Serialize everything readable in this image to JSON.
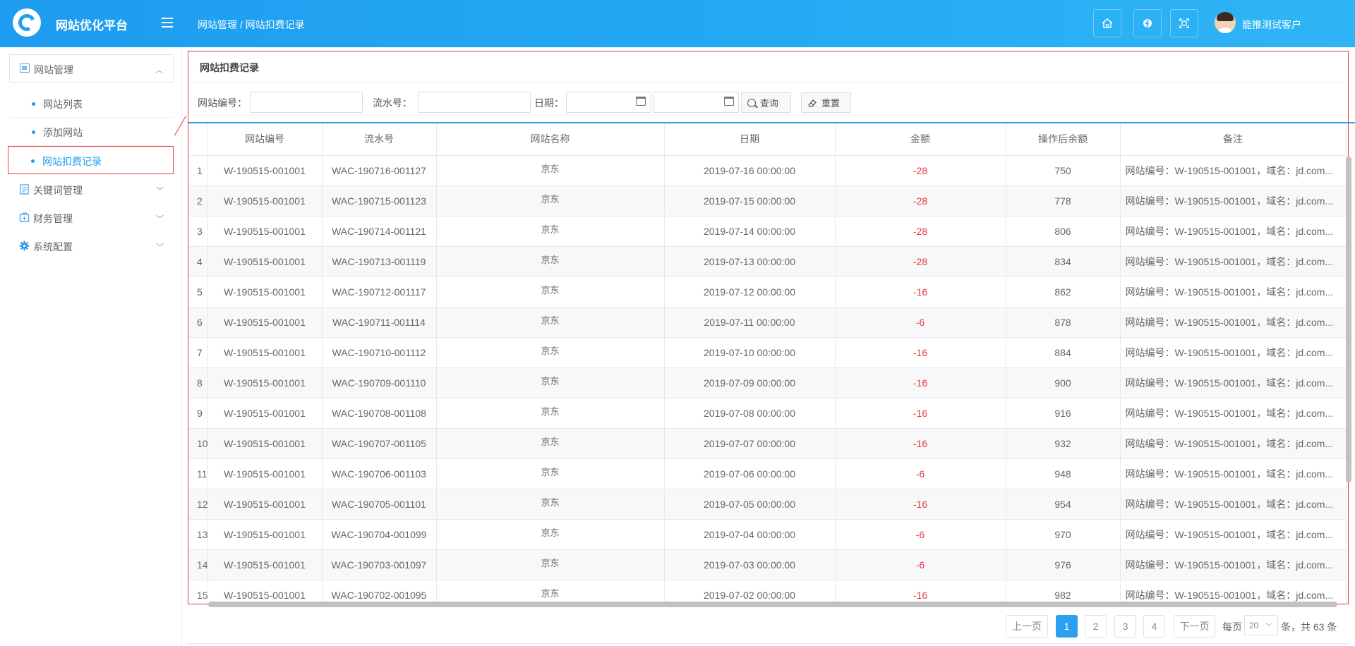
{
  "header": {
    "app_title": "网站优化平台",
    "breadcrumb": "网站管理 / 网站扣费记录",
    "user_name": "能推测试客户"
  },
  "sidebar": {
    "group_label": "网站管理",
    "sub_items": [
      {
        "label": "网站列表"
      },
      {
        "label": "添加网站"
      },
      {
        "label": "网站扣费记录"
      }
    ],
    "menu_items": [
      {
        "label": "关键词管理"
      },
      {
        "label": "财务管理"
      },
      {
        "label": "系统配置"
      }
    ]
  },
  "main": {
    "panel_title": "网站扣费记录",
    "filters": {
      "site_no_label": "网站编号：",
      "site_no_value": "",
      "serial_label": "流水号：",
      "serial_value": "",
      "date_label": "日期：",
      "date_start": "",
      "date_end": "",
      "search_btn": "查询",
      "reset_btn": "重置"
    },
    "columns": [
      "网站编号",
      "流水号",
      "网站名称",
      "日期",
      "金额",
      "操作后余额",
      "备注"
    ],
    "rows": [
      {
        "idx": "1",
        "site_no": "W-190515-001001",
        "serial": "WAC-190716-001127",
        "name": "京东",
        "date": "2019-07-16 00:00:00",
        "amount": "-28",
        "balance": "750",
        "note": "网站编号：W-190515-001001，域名：jd.com..."
      },
      {
        "idx": "2",
        "site_no": "W-190515-001001",
        "serial": "WAC-190715-001123",
        "name": "京东",
        "date": "2019-07-15 00:00:00",
        "amount": "-28",
        "balance": "778",
        "note": "网站编号：W-190515-001001，域名：jd.com..."
      },
      {
        "idx": "3",
        "site_no": "W-190515-001001",
        "serial": "WAC-190714-001121",
        "name": "京东",
        "date": "2019-07-14 00:00:00",
        "amount": "-28",
        "balance": "806",
        "note": "网站编号：W-190515-001001，域名：jd.com..."
      },
      {
        "idx": "4",
        "site_no": "W-190515-001001",
        "serial": "WAC-190713-001119",
        "name": "京东",
        "date": "2019-07-13 00:00:00",
        "amount": "-28",
        "balance": "834",
        "note": "网站编号：W-190515-001001，域名：jd.com..."
      },
      {
        "idx": "5",
        "site_no": "W-190515-001001",
        "serial": "WAC-190712-001117",
        "name": "京东",
        "date": "2019-07-12 00:00:00",
        "amount": "-16",
        "balance": "862",
        "note": "网站编号：W-190515-001001，域名：jd.com..."
      },
      {
        "idx": "6",
        "site_no": "W-190515-001001",
        "serial": "WAC-190711-001114",
        "name": "京东",
        "date": "2019-07-11 00:00:00",
        "amount": "-6",
        "balance": "878",
        "note": "网站编号：W-190515-001001，域名：jd.com..."
      },
      {
        "idx": "7",
        "site_no": "W-190515-001001",
        "serial": "WAC-190710-001112",
        "name": "京东",
        "date": "2019-07-10 00:00:00",
        "amount": "-16",
        "balance": "884",
        "note": "网站编号：W-190515-001001，域名：jd.com..."
      },
      {
        "idx": "8",
        "site_no": "W-190515-001001",
        "serial": "WAC-190709-001110",
        "name": "京东",
        "date": "2019-07-09 00:00:00",
        "amount": "-16",
        "balance": "900",
        "note": "网站编号：W-190515-001001，域名：jd.com..."
      },
      {
        "idx": "9",
        "site_no": "W-190515-001001",
        "serial": "WAC-190708-001108",
        "name": "京东",
        "date": "2019-07-08 00:00:00",
        "amount": "-16",
        "balance": "916",
        "note": "网站编号：W-190515-001001，域名：jd.com..."
      },
      {
        "idx": "10",
        "site_no": "W-190515-001001",
        "serial": "WAC-190707-001105",
        "name": "京东",
        "date": "2019-07-07 00:00:00",
        "amount": "-16",
        "balance": "932",
        "note": "网站编号：W-190515-001001，域名：jd.com..."
      },
      {
        "idx": "11",
        "site_no": "W-190515-001001",
        "serial": "WAC-190706-001103",
        "name": "京东",
        "date": "2019-07-06 00:00:00",
        "amount": "-6",
        "balance": "948",
        "note": "网站编号：W-190515-001001，域名：jd.com..."
      },
      {
        "idx": "12",
        "site_no": "W-190515-001001",
        "serial": "WAC-190705-001101",
        "name": "京东",
        "date": "2019-07-05 00:00:00",
        "amount": "-16",
        "balance": "954",
        "note": "网站编号：W-190515-001001，域名：jd.com..."
      },
      {
        "idx": "13",
        "site_no": "W-190515-001001",
        "serial": "WAC-190704-001099",
        "name": "京东",
        "date": "2019-07-04 00:00:00",
        "amount": "-6",
        "balance": "970",
        "note": "网站编号：W-190515-001001，域名：jd.com..."
      },
      {
        "idx": "14",
        "site_no": "W-190515-001001",
        "serial": "WAC-190703-001097",
        "name": "京东",
        "date": "2019-07-03 00:00:00",
        "amount": "-6",
        "balance": "976",
        "note": "网站编号：W-190515-001001，域名：jd.com..."
      },
      {
        "idx": "15",
        "site_no": "W-190515-001001",
        "serial": "WAC-190702-001095",
        "name": "京东",
        "date": "2019-07-02 00:00:00",
        "amount": "-16",
        "balance": "982",
        "note": "网站编号：W-190515-001001，域名：jd.com..."
      }
    ]
  },
  "pagination": {
    "prev": "上一页",
    "pages": [
      "1",
      "2",
      "3",
      "4"
    ],
    "current": "1",
    "next": "下一页",
    "per_page_label": "每页",
    "per_page": "20",
    "total_text": "条，共 63 条"
  },
  "colors": {
    "header_blue": "#1e9cf0",
    "amount_red": "#e8383d",
    "accent": "#2ba0f0"
  },
  "icons": {
    "header_buttons": [
      "home-icon",
      "refresh-icon",
      "fullscreen-icon"
    ]
  }
}
